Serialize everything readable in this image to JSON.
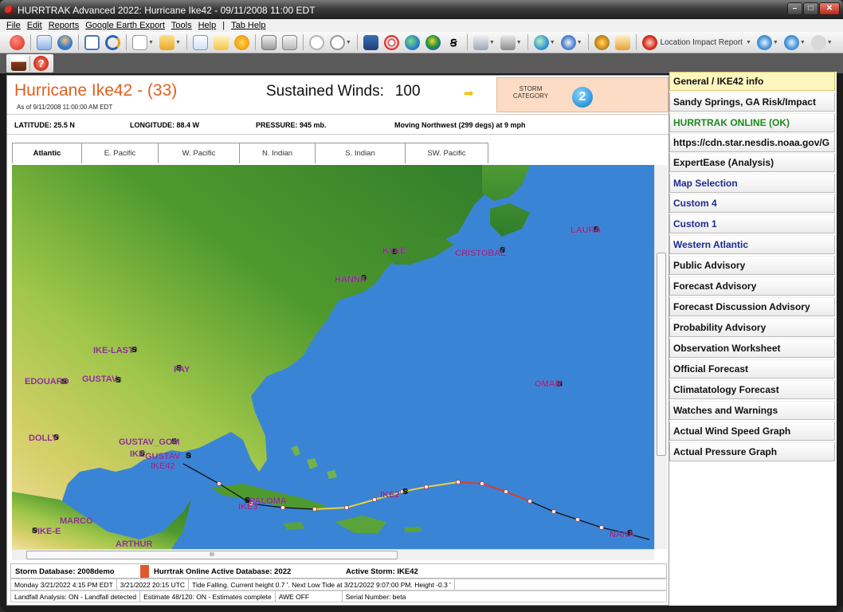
{
  "window": {
    "title": "HURRTRAK Advanced 2022: Hurricane Ike42 - 09/11/2008 11:00 EDT"
  },
  "menu": [
    "File",
    "Edit",
    "Reports",
    "Google Earth Export",
    "Tools",
    "Help",
    "|",
    "Tab Help"
  ],
  "toolbar": {
    "location_impact_label": "Location Impact Report"
  },
  "header": {
    "storm_name": "Hurricane Ike42 - (33)",
    "as_of": "As of 9/11/2008 11:00:00 AM EDT",
    "sustained_label": "Sustained Winds:",
    "sustained_value": "100",
    "category_label": "STORM CATEGORY",
    "category_value": "2"
  },
  "info": {
    "latitude": "LATITUDE: 25.5 N",
    "longitude": "LONGITUDE: 88.4 W",
    "pressure": "PRESSURE:  945 mb.",
    "motion": "Moving Northwest (299 degs) at 9 mph"
  },
  "tabs": [
    "Atlantic",
    "E. Pacific",
    "W. Pacific",
    "N. Indian",
    "S. Indian",
    "SW. Pacific"
  ],
  "map_labels": {
    "laura": "LAURA",
    "kyle": "KYLE",
    "cristobal": "CRISTOBAL",
    "hanna": "HANNA",
    "ike_last": "IKE-LAST",
    "fay": "FAY",
    "edouard": "EDOUARD",
    "gustav": "GUSTAV",
    "omar": "OMAR",
    "dolly": "DOLLY",
    "gustav_gom": "GUSTAV_GOM",
    "ike": "IKE",
    "gustav2": "GUSTAV",
    "ike42": "IKE42",
    "paloma": "PALOMA",
    "ike3": "IKE3",
    "ike2": "IKE2",
    "marco": "MARCO",
    "ike_e": "IKE-E",
    "arthur": "ARTHUR",
    "nana": "NANA"
  },
  "status": {
    "storm_db": "Storm Database: 2008demo",
    "online_db": "Hurrtrak Online Active Database: 2022",
    "active_storm": "Active Storm: IKE42",
    "datetime_local": "Monday  3/21/2022 4:15 PM EDT",
    "datetime_utc": "3/21/2022 20:15 UTC",
    "tide": "Tide Falling. Current height 0.7 '. Next Low Tide at 3/21/2022 9:07:00 PM. Height -0.3 '",
    "landfall": "Landfall Analysis: ON - Landfall detected",
    "estimate": "Estimate 48/120: ON - Estimates complete",
    "awe": "AWE OFF",
    "serial": "Serial Number: beta"
  },
  "right_panel": [
    "General / IKE42 info",
    "Sandy Springs, GA Risk/Impact",
    "HURRTRAK ONLINE (OK)",
    "https://cdn.star.nesdis.noaa.gov/G",
    "ExpertEase (Analysis)",
    "Map Selection",
    "Custom 4",
    "Custom 1",
    "Western Atlantic",
    "Public Advisory",
    "Forecast Advisory",
    "Forecast Discussion Advisory",
    "Probability Advisory",
    "Observation Worksheet",
    "Official Forecast",
    "Climatatology Forecast",
    "Watches and Warnings",
    "Actual Wind Speed Graph",
    "Actual Pressure Graph"
  ]
}
